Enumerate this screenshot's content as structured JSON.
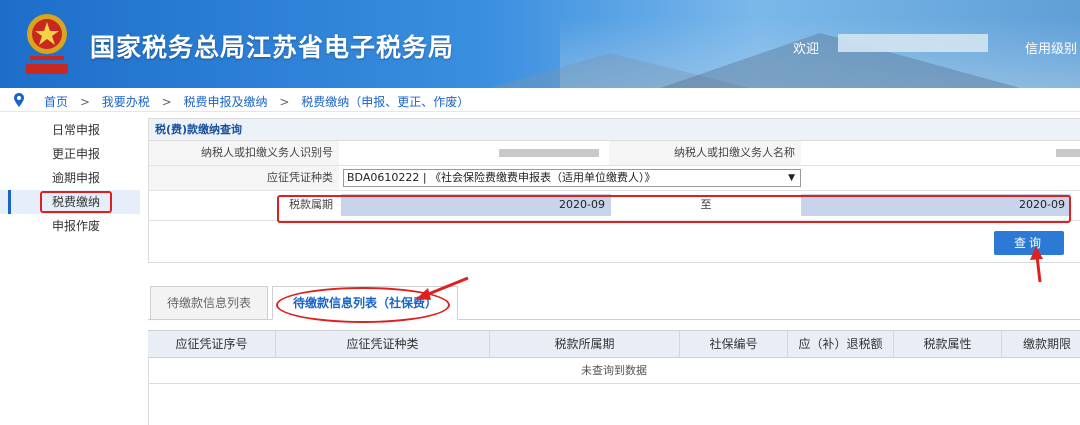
{
  "header": {
    "title": "国家税务总局江苏省电子税务局",
    "welcome": "欢迎",
    "credit_level": "信用级别"
  },
  "breadcrumb": {
    "items": [
      "首页",
      "我要办税",
      "税费申报及缴纳",
      "税费缴纳（申报、更正、作废）"
    ],
    "separator": ">"
  },
  "sidebar": {
    "items": [
      {
        "label": "日常申报",
        "active": false
      },
      {
        "label": "更正申报",
        "active": false
      },
      {
        "label": "逾期申报",
        "active": false
      },
      {
        "label": "税费缴纳",
        "active": true
      },
      {
        "label": "申报作废",
        "active": false
      }
    ]
  },
  "query_panel": {
    "title": "税(费)款缴纳查询",
    "taxpayer_id_label": "纳税人或扣缴义务人识别号",
    "taxpayer_name_label": "纳税人或扣缴义务人名称",
    "voucher_type_label": "应征凭证种类",
    "voucher_type_value": "BDA0610222 | 《社会保险费缴费申报表（适用单位缴费人）》",
    "period_label": "税款属期",
    "period_from": "2020-09",
    "period_to_label": "至",
    "period_to": "2020-09",
    "query_button": "查询"
  },
  "tabs": [
    {
      "label": "待缴款信息列表",
      "active": false
    },
    {
      "label": "待缴款信息列表（社保费）",
      "active": true
    }
  ],
  "table": {
    "columns": [
      "应征凭证序号",
      "应征凭证种类",
      "税款所属期",
      "社保编号",
      "应（补）退税额",
      "税款属性",
      "缴款期限"
    ],
    "empty_text": "未查询到数据"
  },
  "colors": {
    "accent": "#2c7ad6",
    "highlight": "#e02020",
    "period_fill": "#c8d4ec"
  }
}
